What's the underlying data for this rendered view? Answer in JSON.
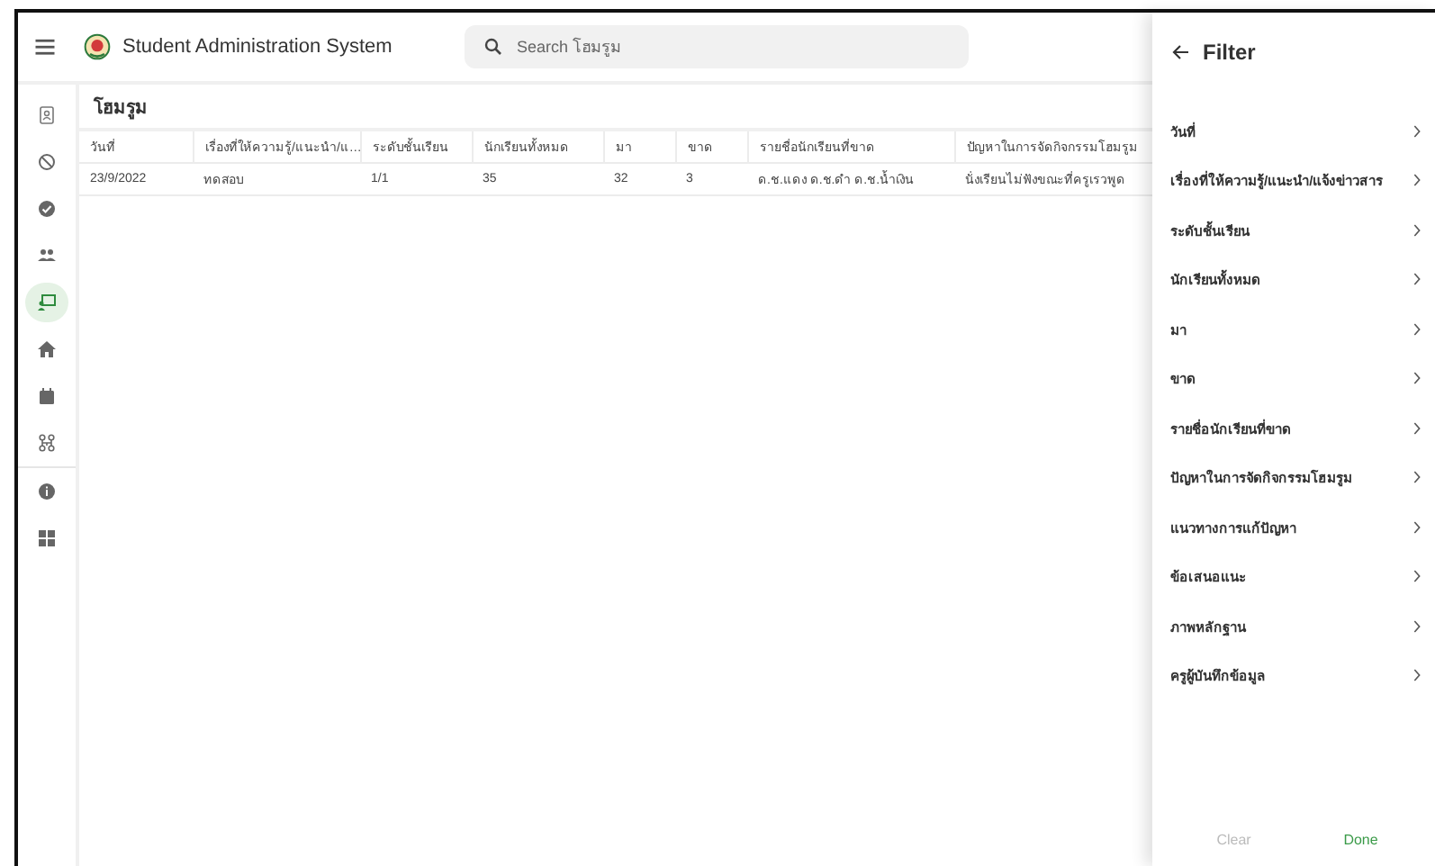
{
  "header": {
    "title": "Student Administration System",
    "search": {
      "placeholder": "Search โฮมรูม"
    }
  },
  "sidebar": {
    "sections": [
      [
        {
          "kind": "contact",
          "selected": false
        },
        {
          "kind": "block",
          "selected": false
        },
        {
          "kind": "check",
          "selected": false
        },
        {
          "kind": "people",
          "selected": false
        },
        {
          "kind": "presentation",
          "selected": true
        },
        {
          "kind": "home",
          "selected": false
        },
        {
          "kind": "calendar",
          "selected": false
        },
        {
          "kind": "network",
          "selected": false
        }
      ],
      [
        {
          "kind": "info",
          "selected": false
        },
        {
          "kind": "grid",
          "selected": false
        }
      ]
    ]
  },
  "page": {
    "title": "โฮมรูม"
  },
  "table": {
    "columns": [
      "วันที่",
      "เรื่องที่ให้ความรู้/แนะนำ/แ…",
      "ระดับชั้นเรียน",
      "นักเรียนทั้งหมด",
      "มา",
      "ขาด",
      "รายชื่อนักเรียนที่ขาด",
      "ปัญหาในการจัดกิจกรรมโฮมรูม"
    ],
    "rows": [
      [
        "23/9/2022",
        "ทดสอบ",
        "1/1",
        "35",
        "32",
        "3",
        "ด.ช.แดง ด.ช.ดำ ด.ช.น้ำเงิน",
        "นั่งเรียนไม่ฟังขณะที่ครูเรวพูด"
      ]
    ]
  },
  "filter": {
    "title": "Filter",
    "items": [
      {
        "label": "วันที่"
      },
      {
        "label": "เรื่องที่ให้ความรู้/แนะนำ/แจ้งข่าวสาร"
      },
      {
        "label": "ระดับชั้นเรียน"
      },
      {
        "label": "นักเรียนทั้งหมด"
      },
      {
        "label": "มา"
      },
      {
        "label": "ขาด"
      },
      {
        "label": "รายชื่อนักเรียนที่ขาด"
      },
      {
        "label": "ปัญหาในการจัดกิจกรรมโฮมรูม"
      },
      {
        "label": "แนวทางการแก้ปัญหา"
      },
      {
        "label": "ข้อเสนอแนะ"
      },
      {
        "label": "ภาพหลักฐาน"
      },
      {
        "label": "ครูผู้บันทึกข้อมูล"
      }
    ],
    "buttons": [
      {
        "label": "Clear",
        "disabled": true
      },
      {
        "label": "Done",
        "disabled": false
      }
    ]
  }
}
